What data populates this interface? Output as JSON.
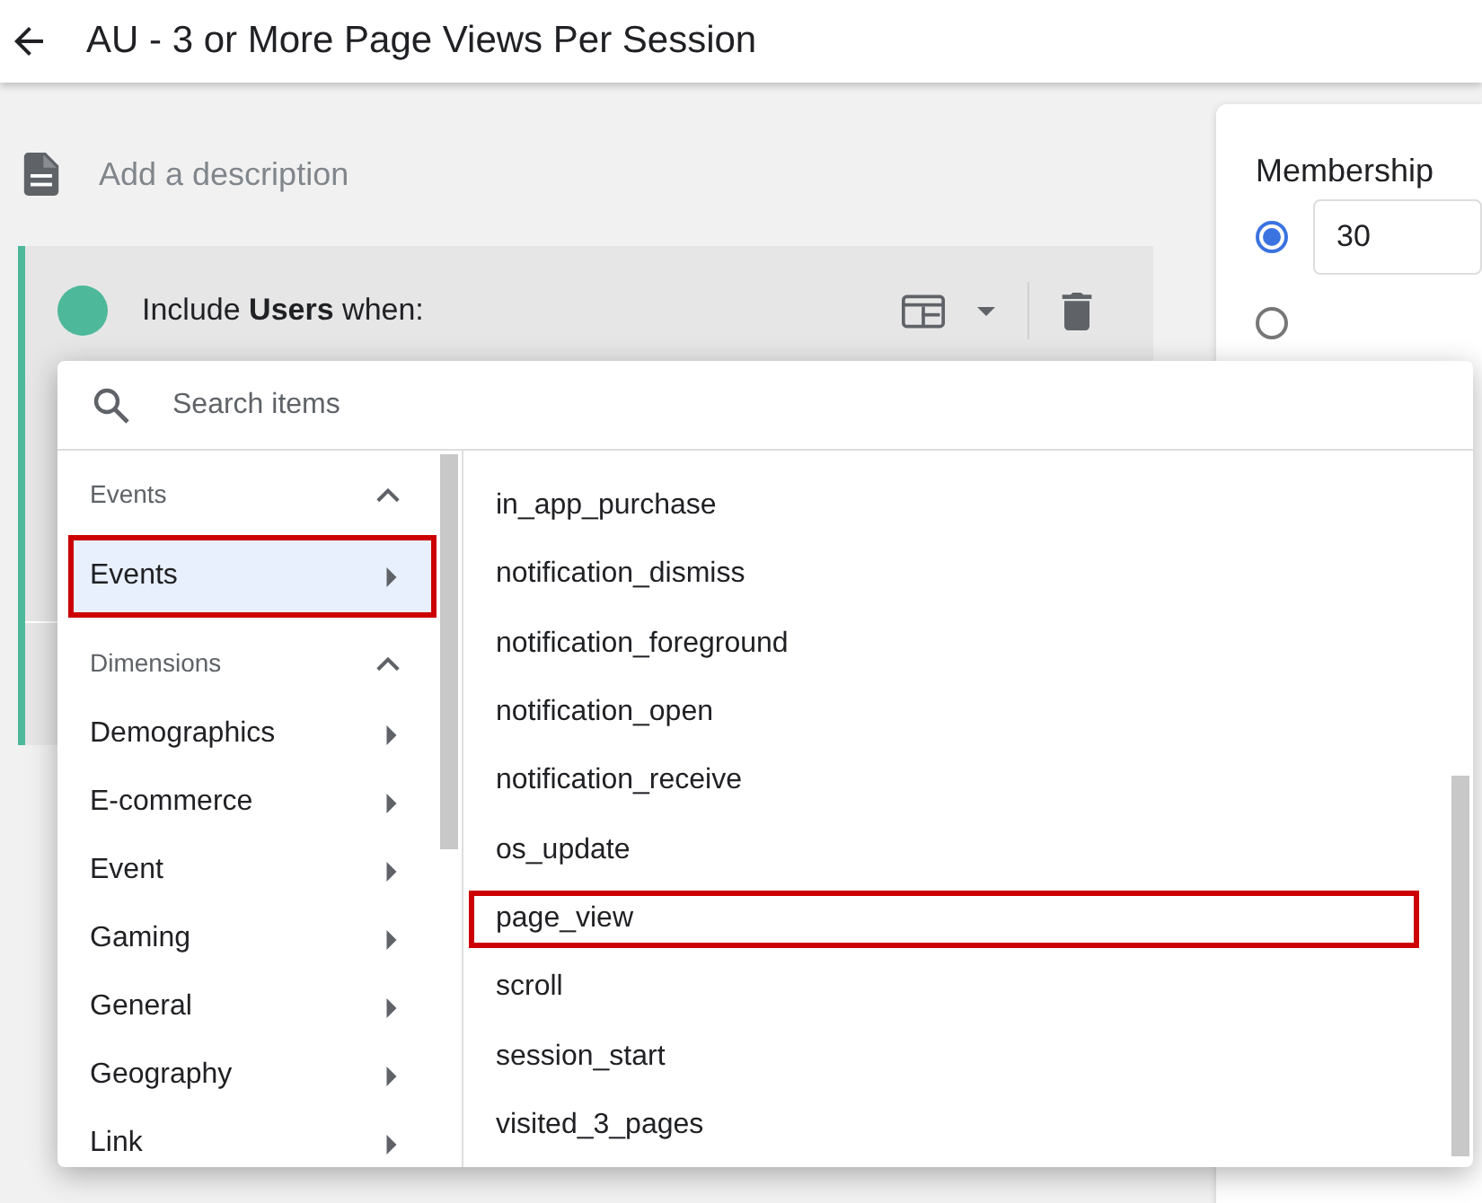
{
  "header": {
    "title": "AU - 3 or More Page Views Per Session"
  },
  "description": {
    "placeholder": "Add a description"
  },
  "condition": {
    "text": "Include **Users** when:"
  },
  "membership": {
    "label": "Membership",
    "options": [
      {
        "selected": true,
        "value": "30"
      },
      {
        "selected": false
      }
    ]
  },
  "picker": {
    "search": {
      "placeholder": "Search items"
    },
    "groups": [
      {
        "title": "Events",
        "expanded": true,
        "items": [
          {
            "label": "Events",
            "selected": true,
            "highlighted": true
          }
        ]
      },
      {
        "title": "Dimensions",
        "expanded": true,
        "items": [
          {
            "label": "Demographics",
            "selected": false,
            "highlighted": false
          },
          {
            "label": "E-commerce",
            "selected": false,
            "highlighted": false
          },
          {
            "label": "Event",
            "selected": false,
            "highlighted": false
          },
          {
            "label": "Gaming",
            "selected": false,
            "highlighted": false
          },
          {
            "label": "General",
            "selected": false,
            "highlighted": false
          },
          {
            "label": "Geography",
            "selected": false,
            "highlighted": false
          },
          {
            "label": "Link",
            "selected": false,
            "highlighted": false
          }
        ]
      }
    ],
    "events": [
      {
        "label": "in_app_purchase",
        "highlighted": false
      },
      {
        "label": "notification_dismiss",
        "highlighted": false
      },
      {
        "label": "notification_foreground",
        "highlighted": false
      },
      {
        "label": "notification_open",
        "highlighted": false
      },
      {
        "label": "notification_receive",
        "highlighted": false
      },
      {
        "label": "os_update",
        "highlighted": false
      },
      {
        "label": "page_view",
        "highlighted": true
      },
      {
        "label": "scroll",
        "highlighted": false
      },
      {
        "label": "session_start",
        "highlighted": false
      },
      {
        "label": "visited_3_pages",
        "highlighted": false
      }
    ]
  }
}
